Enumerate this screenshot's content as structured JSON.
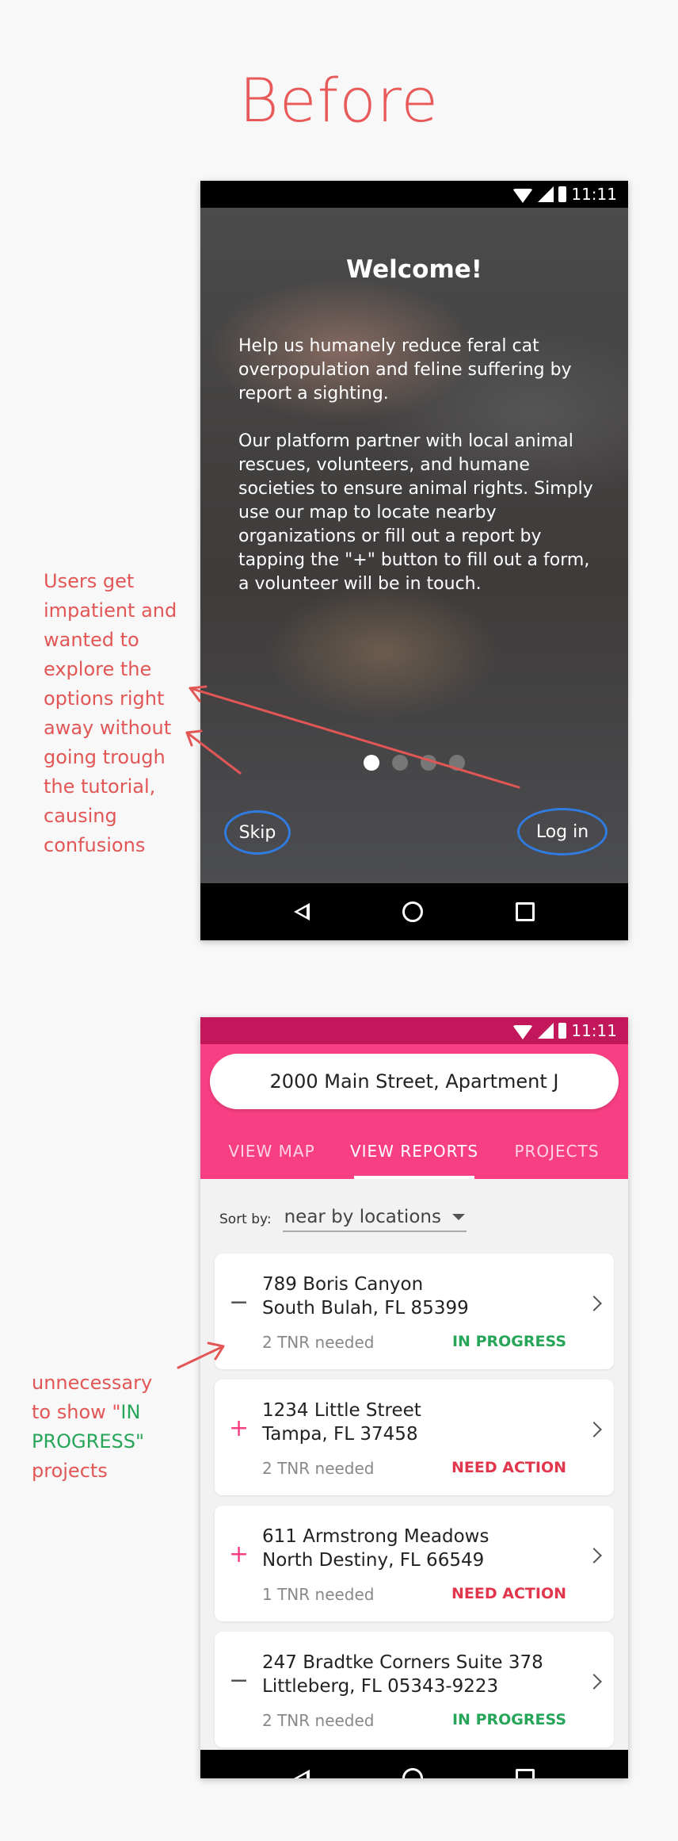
{
  "heading": "Before",
  "notes": {
    "note1": [
      "Users get",
      "impatient and",
      "wanted to",
      "explore the",
      "options right",
      "away without",
      "going trough",
      "the tutorial,",
      "causing",
      "confusions"
    ],
    "note2": {
      "line1": "unnecessary",
      "line2_pre": "to show \"",
      "line2_green": "IN",
      "line3_green": "PROGRESS\"",
      "line4": "projects"
    }
  },
  "welcome_screen": {
    "status_time": "11:11",
    "title": "Welcome!",
    "paragraph1": "Help us humanely reduce feral cat overpopulation and feline suffering by report a sighting.",
    "paragraph2": "Our platform partner with local animal rescues, volunteers, and humane societies to ensure animal rights. Simply use our map to locate nearby organizations or fill out a report by tapping the \"+\" button to fill out a form, a volunteer will be in touch.",
    "dots_total": 4,
    "dots_active": 1,
    "skip_label": "Skip",
    "login_label": "Log in"
  },
  "reports_screen": {
    "status_time": "11:11",
    "address": "2000 Main Street, Apartment J",
    "tabs": [
      {
        "label": "VIEW MAP",
        "active": false
      },
      {
        "label": "VIEW REPORTS",
        "active": true
      },
      {
        "label": "PROJECTS",
        "active": false
      }
    ],
    "sort_label": "Sort by:",
    "sort_value": "near by locations",
    "reports": [
      {
        "line1": "789 Boris Canyon",
        "line2": "South Bulah, FL 85399",
        "need": "2 TNR needed",
        "status": "IN PROGRESS",
        "indicator": "minus"
      },
      {
        "line1": "1234 Little Street",
        "line2": "Tampa, FL 37458",
        "need": "2 TNR needed",
        "status": "NEED ACTION",
        "indicator": "plus"
      },
      {
        "line1": "611 Armstrong Meadows",
        "line2": "North Destiny, FL 66549",
        "need": "1 TNR needed",
        "status": "NEED ACTION",
        "indicator": "plus"
      },
      {
        "line1": "247 Bradtke Corners Suite 378",
        "line2": "Littleberg, FL 05343-9223",
        "need": "2 TNR needed",
        "status": "IN PROGRESS",
        "indicator": "minus"
      }
    ]
  },
  "colors": {
    "accent_pink": "#f83f83",
    "annotation_red": "#e25656",
    "annotation_green": "#27a65a",
    "highlight_blue": "#2f7be0"
  }
}
